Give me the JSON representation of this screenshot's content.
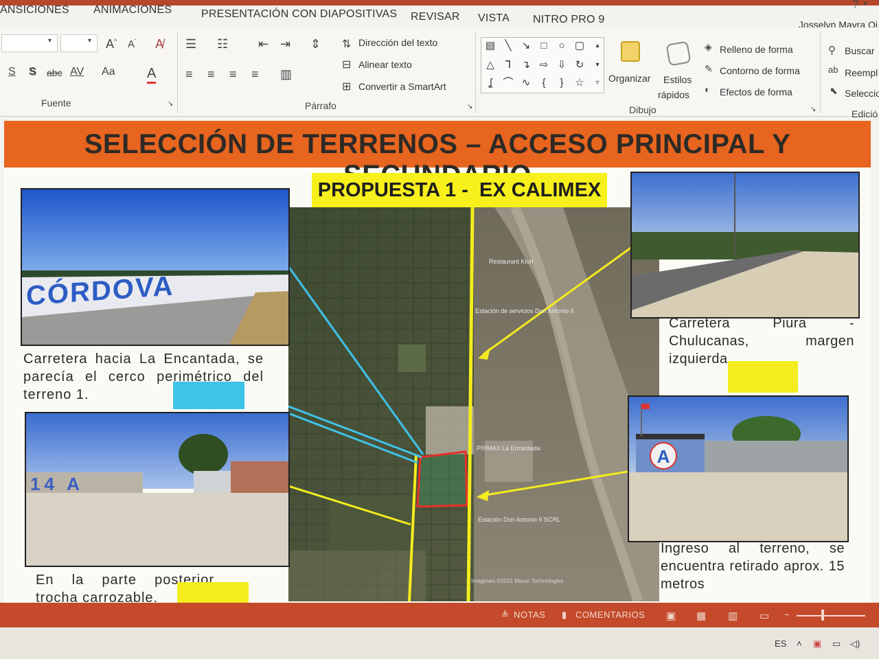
{
  "ribbon_tabs": [
    "ANSICIONES",
    "ANIMACIONES",
    "PRESENTACIÓN CON DIAPOSITIVAS",
    "REVISAR",
    "VISTA",
    "NITRO PRO 9"
  ],
  "user": "Josselyn Mayra Oj",
  "help": "?",
  "groups": {
    "fuente": "Fuente",
    "parrafo": "Párrafo",
    "dibujo": "Dibujo",
    "edicion": "Edició"
  },
  "fuente_buttons": {
    "strike": "abc",
    "spacing": "AV",
    "case": "Aa"
  },
  "parrafo_buttons": {
    "direccion": "Dirección del texto",
    "alinear": "Alinear texto",
    "convertir": "Convertir a SmartArt"
  },
  "dibujo_buttons": {
    "organizar": "Organizar",
    "estilos_1": "Estilos",
    "estilos_2": "rápidos",
    "relleno": "Relleno de forma",
    "contorno": "Contorno de forma",
    "efectos": "Efectos de forma"
  },
  "edicion_buttons": {
    "buscar": "Buscar",
    "reemplazar": "Reempl",
    "seleccionar": "Seleccio"
  },
  "colors": {
    "banner": "#e7651f",
    "highlight": "#f7f01c",
    "cyan_line": "#3fc3e8",
    "yellow_line": "#f4ec1e",
    "red_parcel": "#e8302a",
    "status": "#c44a2b"
  },
  "slide": {
    "title": "SELECCIÓN DE TERRENOS – ACCESO PRINCIPAL Y SECUNDARIO",
    "proposal": "PROPUESTA 1 -  EX CALIMEX",
    "photos": {
      "top_left_sign": "CÓRDOVA",
      "bottom_left_sign": "14 A",
      "bottom_right_sign": "A"
    },
    "captions": {
      "top_left": "Carretera hacia La Encantada, se parecía el cerco perimétrico del terreno 1.",
      "bottom_left": "En la parte posterior trocha carrozable.",
      "top_right": "Carretera Piura - Chulucanas, margen izquierda.",
      "bottom_right": "Ingreso al terreno, se encuentra retirado aprox. 15 metros"
    },
    "map_labels": {
      "restaurant": "Restaurant Kiuri",
      "estacion_1": "Estación de servicios Don Antonio II",
      "primax": "PRIMAX La Encantada",
      "estacion_2": "Estación Don Antonio II SCRL",
      "imagery": "Imágenes ©2021 Maxar Technologies"
    }
  },
  "statusbar": {
    "notas": "NOTAS",
    "comentarios": "COMENTARIOS"
  },
  "taskbar": {
    "lang": "ES"
  }
}
